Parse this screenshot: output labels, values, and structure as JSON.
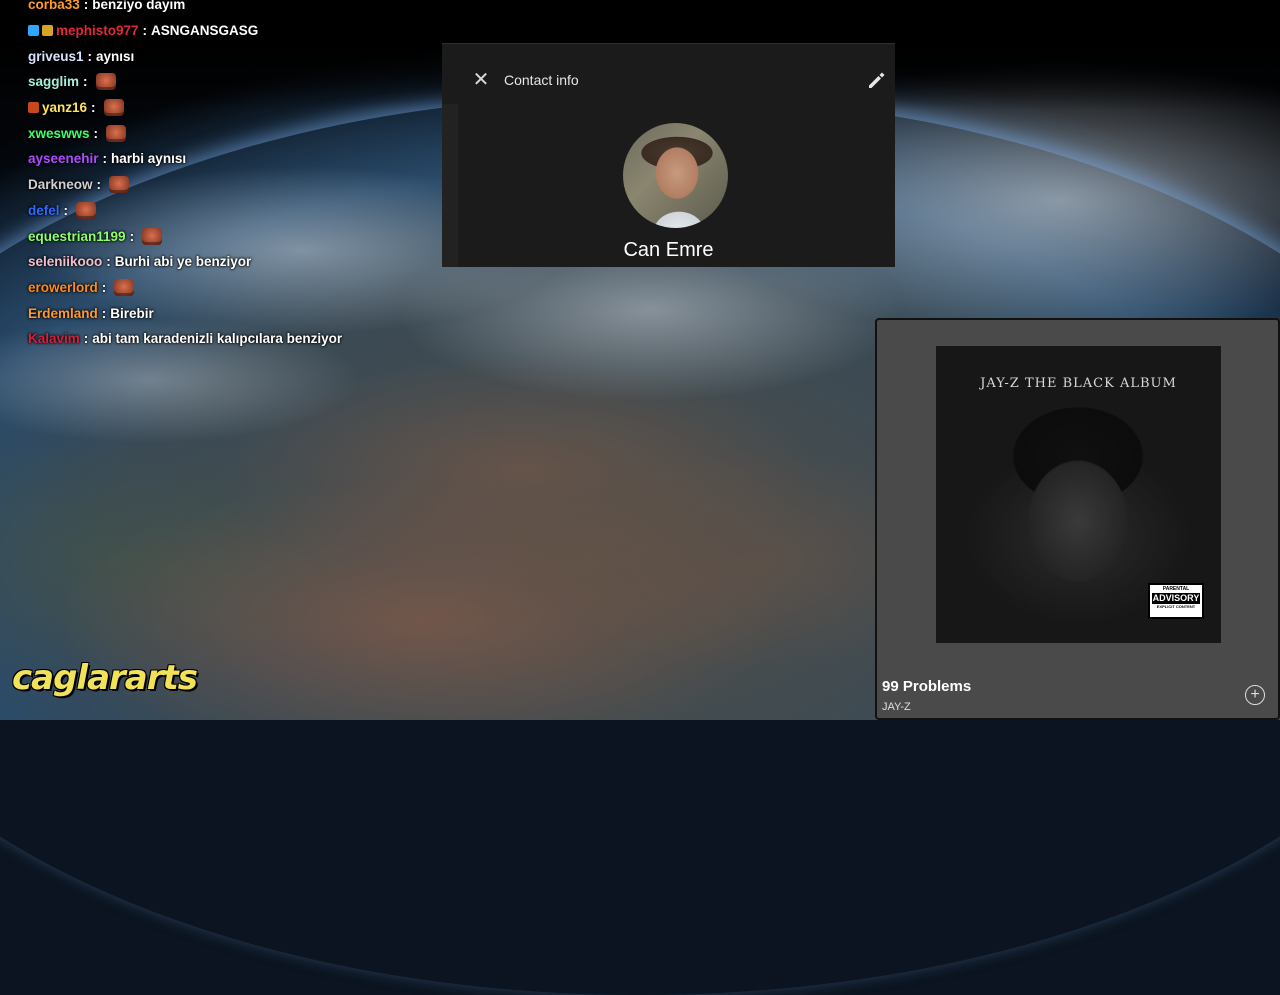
{
  "chat": [
    {
      "user": "corba33",
      "color": "#ff9a2e",
      "text": "benziyo dayım",
      "emote": false,
      "badges": []
    },
    {
      "user": "mephisto977",
      "color": "#e0283c",
      "text": "ASNGANSGASG",
      "emote": false,
      "badges": [
        "#2ea8ff",
        "#d8a328"
      ]
    },
    {
      "user": "griveus1",
      "color": "#d6e4ff",
      "text": "aynısı",
      "emote": false,
      "badges": []
    },
    {
      "user": "sagglim",
      "color": "#a6f0d8",
      "text": "",
      "emote": true,
      "badges": []
    },
    {
      "user": "yanz16",
      "color": "#ffe45c",
      "text": "",
      "emote": true,
      "badges": [
        "#c8481e"
      ]
    },
    {
      "user": "xweswws",
      "color": "#3dff6a",
      "text": "",
      "emote": true,
      "badges": []
    },
    {
      "user": "ayseenehir",
      "color": "#b04bff",
      "text": "harbi aynısı",
      "emote": false,
      "badges": []
    },
    {
      "user": "Darkneow",
      "color": "#d0d0d0",
      "text": "",
      "emote": true,
      "badges": []
    },
    {
      "user": "defel",
      "color": "#2b6bff",
      "text": "",
      "emote": true,
      "badges": []
    },
    {
      "user": "equestrian1199",
      "color": "#8cff6a",
      "text": "",
      "emote": true,
      "badges": []
    },
    {
      "user": "seleniikooo",
      "color": "#f0c0d0",
      "text": "Burhi abi ye benziyor",
      "emote": false,
      "badges": []
    },
    {
      "user": "erowerlord",
      "color": "#ff8a1e",
      "text": "",
      "emote": true,
      "badges": []
    },
    {
      "user": "Erdemland",
      "color": "#ff9a2e",
      "text": "Birebir",
      "emote": false,
      "badges": []
    },
    {
      "user": "Kalavim",
      "color": "#d81e3c",
      "text": "abi tam karadenizli kalıpcılara benziyor",
      "emote": false,
      "badges": []
    }
  ],
  "contact": {
    "title": "Contact info",
    "name": "Can Emre",
    "close_icon": "close-icon",
    "edit_icon": "pencil-icon"
  },
  "music": {
    "album_title": "JAY-Z THE BLACK ALBUM",
    "advisory_top": "PARENTAL",
    "advisory_mid": "ADVISORY",
    "advisory_bottom": "EXPLICIT CONTENT",
    "track": "99 Problems",
    "artist": "JAY-Z",
    "add_icon": "plus-circle-icon"
  },
  "watermark": "caglararts"
}
